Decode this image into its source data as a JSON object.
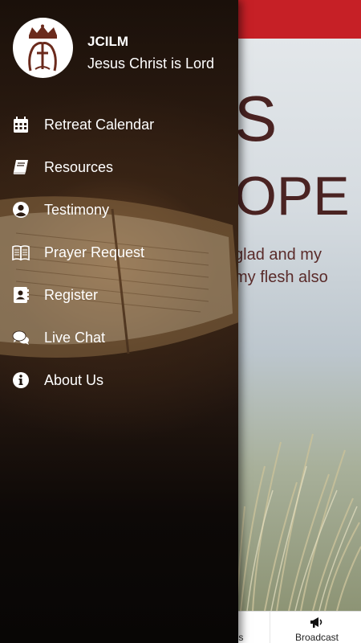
{
  "drawer": {
    "app_name": "JCILM",
    "subtitle": "Jesus Christ is Lord",
    "items": [
      {
        "label": "Retreat Calendar",
        "icon": "calendar-icon"
      },
      {
        "label": "Resources",
        "icon": "book-icon"
      },
      {
        "label": "Testimony",
        "icon": "user-circle-icon"
      },
      {
        "label": "Prayer Request",
        "icon": "open-book-icon"
      },
      {
        "label": "Register",
        "icon": "contact-card-icon"
      },
      {
        "label": "Live Chat",
        "icon": "chat-bubbles-icon"
      },
      {
        "label": "About Us",
        "icon": "info-icon"
      }
    ]
  },
  "background": {
    "hero_line1": "S",
    "hero_line2": "OPE",
    "verse_line1": "glad and my",
    "verse_line2": "my flesh also",
    "header_color": "#c62026"
  },
  "bottom_nav": {
    "records_label": "rds",
    "broadcast_label": "Broadcast",
    "broadcast_icon": "megaphone-icon"
  }
}
